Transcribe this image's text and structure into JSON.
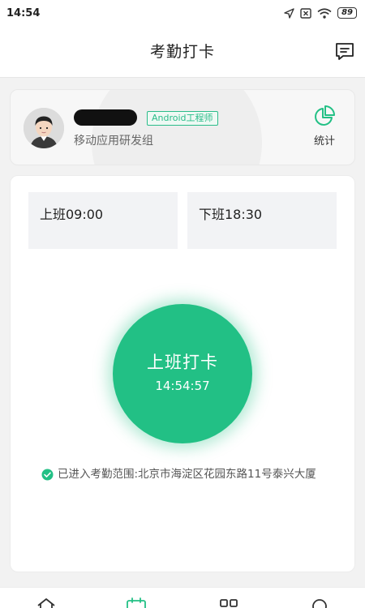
{
  "status_bar": {
    "time": "14:54",
    "battery": "89",
    "icons": [
      "location-arrow-icon",
      "no-sim-icon",
      "wifi-icon",
      "battery-icon"
    ]
  },
  "header": {
    "title": "考勤打卡",
    "message_icon": "message-icon"
  },
  "profile": {
    "role_badge": "Android工程师",
    "department": "移动应用研发组",
    "stats_label": "统计",
    "stats_icon": "pie-chart-icon"
  },
  "shifts": {
    "start": "上班09:00",
    "end": "下班18:30"
  },
  "clock_in": {
    "label": "上班打卡",
    "time": "14:54:57"
  },
  "location": {
    "text": "已进入考勤范围:北京市海淀区花园东路11号泰兴大厦",
    "icon": "check-circle-icon"
  },
  "bottom_nav": {
    "icons": [
      "home-icon",
      "calendar-icon",
      "apps-icon",
      "search-icon"
    ]
  },
  "colors": {
    "accent": "#22c085",
    "badge": "#2bbd8a",
    "background": "#f2f2f2"
  }
}
